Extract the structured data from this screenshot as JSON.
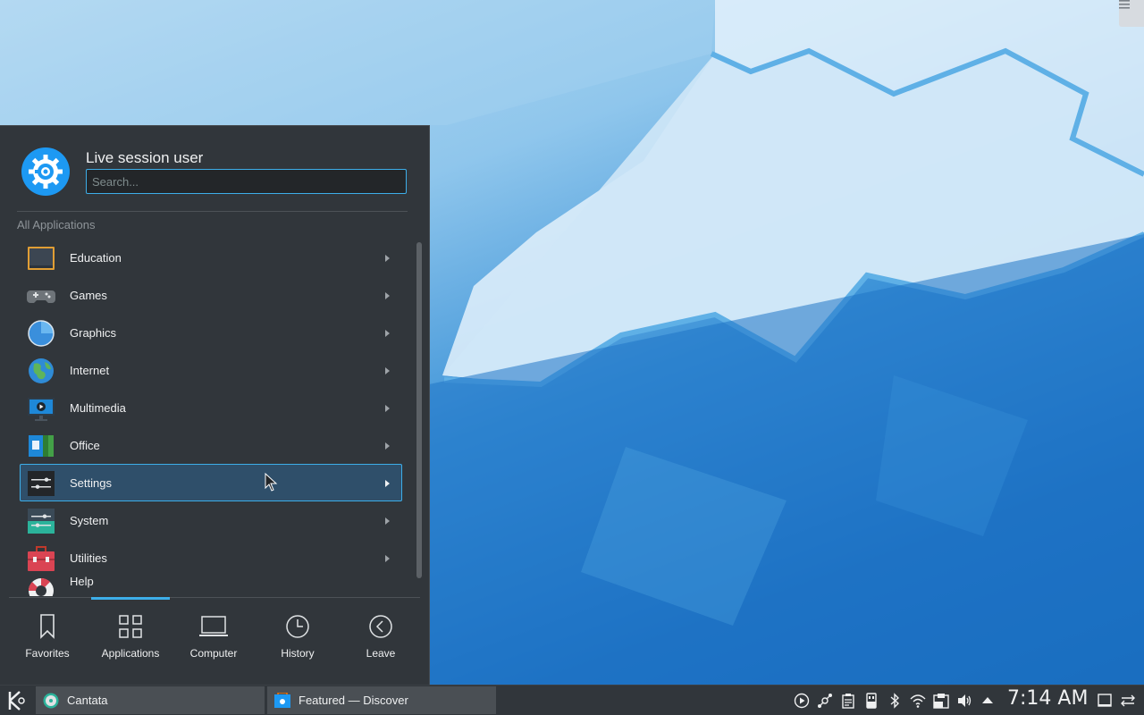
{
  "launcher": {
    "username": "Live session user",
    "search_placeholder": "Search...",
    "section_label": "All Applications",
    "categories": [
      {
        "label": "Education",
        "icon": "education-chalkboard-icon"
      },
      {
        "label": "Games",
        "icon": "gamepad-icon"
      },
      {
        "label": "Graphics",
        "icon": "graphics-icon"
      },
      {
        "label": "Internet",
        "icon": "globe-icon"
      },
      {
        "label": "Multimedia",
        "icon": "multimedia-icon"
      },
      {
        "label": "Office",
        "icon": "office-icon"
      },
      {
        "label": "Settings",
        "icon": "settings-sliders-icon"
      },
      {
        "label": "System",
        "icon": "system-icon"
      },
      {
        "label": "Utilities",
        "icon": "toolbox-icon"
      },
      {
        "label": "Help",
        "icon": "lifebuoy-icon"
      }
    ],
    "hovered_category": "Settings",
    "tabs": [
      {
        "label": "Favorites",
        "icon": "bookmark-icon"
      },
      {
        "label": "Applications",
        "icon": "grid-icon"
      },
      {
        "label": "Computer",
        "icon": "laptop-icon"
      },
      {
        "label": "History",
        "icon": "clock-icon"
      },
      {
        "label": "Leave",
        "icon": "back-arrow-icon"
      }
    ],
    "active_tab": "Applications"
  },
  "taskbar": {
    "tasks": [
      {
        "label": "Cantata",
        "icon": "cantata-icon"
      },
      {
        "label": "Featured — Discover",
        "icon": "discover-icon"
      }
    ],
    "tray": [
      "media-play-icon",
      "kde-connect-icon",
      "clipboard-icon",
      "usb-device-icon",
      "bluetooth-icon",
      "wifi-icon",
      "updates-icon",
      "volume-icon",
      "expand-tray-icon"
    ],
    "clock": "7:14 AM"
  },
  "colors": {
    "accent": "#3daee9",
    "panel_bg": "#31363b",
    "text": "#eff0f1"
  }
}
